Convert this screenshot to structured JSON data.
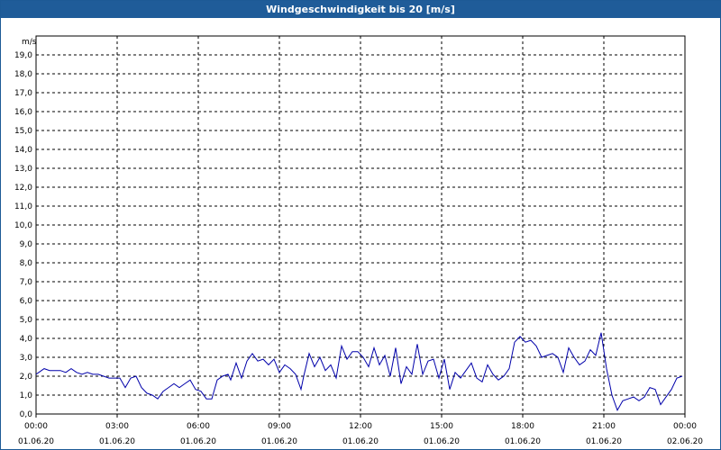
{
  "window": {
    "title": "Windgeschwindigkeit bis 20 [m/s]"
  },
  "colors": {
    "titlebar": "#1f5c99",
    "series": "#0000aa",
    "grid": "#000000"
  },
  "chart_data": {
    "type": "line",
    "title": "Windgeschwindigkeit bis 20 [m/s]",
    "ylabel": "m/s",
    "xlabel": "",
    "ylim": [
      0,
      20
    ],
    "xlim": [
      0,
      24
    ],
    "grid": true,
    "y_ticks": [
      "0,0",
      "1,0",
      "2,0",
      "3,0",
      "4,0",
      "5,0",
      "6,0",
      "7,0",
      "8,0",
      "9,0",
      "10,0",
      "11,0",
      "12,0",
      "13,0",
      "14,0",
      "15,0",
      "16,0",
      "17,0",
      "18,0",
      "19,0"
    ],
    "x_ticks": [
      {
        "time": "00:00",
        "date": "01.06.20",
        "hour": 0
      },
      {
        "time": "03:00",
        "date": "01.06.20",
        "hour": 3
      },
      {
        "time": "06:00",
        "date": "01.06.20",
        "hour": 6
      },
      {
        "time": "09:00",
        "date": "01.06.20",
        "hour": 9
      },
      {
        "time": "12:00",
        "date": "01.06.20",
        "hour": 12
      },
      {
        "time": "15:00",
        "date": "01.06.20",
        "hour": 15
      },
      {
        "time": "18:00",
        "date": "01.06.20",
        "hour": 18
      },
      {
        "time": "21:00",
        "date": "01.06.20",
        "hour": 21
      },
      {
        "time": "00:00",
        "date": "02.06.20",
        "hour": 24
      }
    ],
    "series": [
      {
        "name": "",
        "x": [
          0,
          0.1,
          0.3,
          0.5,
          0.7,
          0.9,
          1.1,
          1.3,
          1.5,
          1.7,
          1.9,
          2.1,
          2.3,
          2.5,
          2.7,
          2.9,
          3.1,
          3.3,
          3.5,
          3.7,
          3.9,
          4.1,
          4.3,
          4.5,
          4.7,
          4.9,
          5.1,
          5.3,
          5.5,
          5.7,
          5.9,
          6.1,
          6.3,
          6.5,
          6.7,
          6.9,
          7.1,
          7.2,
          7.4,
          7.6,
          7.8,
          8.0,
          8.2,
          8.4,
          8.6,
          8.8,
          9.0,
          9.2,
          9.4,
          9.6,
          9.8,
          9.9,
          10.1,
          10.3,
          10.5,
          10.7,
          10.9,
          11.1,
          11.3,
          11.5,
          11.7,
          11.9,
          12.1,
          12.3,
          12.5,
          12.7,
          12.9,
          13.1,
          13.3,
          13.5,
          13.7,
          13.9,
          14.1,
          14.3,
          14.5,
          14.7,
          14.9,
          15.1,
          15.3,
          15.5,
          15.7,
          15.9,
          16.1,
          16.3,
          16.5,
          16.7,
          16.9,
          17.1,
          17.3,
          17.5,
          17.7,
          17.9,
          18.1,
          18.3,
          18.5,
          18.7,
          18.9,
          19.1,
          19.3,
          19.5,
          19.7,
          19.9,
          20.1,
          20.3,
          20.5,
          20.7,
          20.9,
          21.1,
          21.3,
          21.5,
          21.7,
          21.9,
          22.1,
          22.3,
          22.5,
          22.7,
          22.9,
          23.1,
          23.3,
          23.5,
          23.7,
          23.9
        ],
        "y": [
          2.1,
          2.2,
          2.4,
          2.3,
          2.3,
          2.3,
          2.2,
          2.4,
          2.2,
          2.1,
          2.2,
          2.1,
          2.1,
          2.0,
          1.9,
          1.9,
          1.9,
          1.4,
          1.9,
          2.0,
          1.4,
          1.1,
          1.0,
          0.8,
          1.2,
          1.4,
          1.6,
          1.4,
          1.6,
          1.8,
          1.3,
          1.2,
          0.8,
          0.8,
          1.8,
          2.0,
          2.1,
          1.8,
          2.7,
          1.9,
          2.8,
          3.2,
          2.8,
          2.9,
          2.6,
          2.9,
          2.2,
          2.6,
          2.4,
          2.1,
          1.3,
          2.0,
          3.2,
          2.5,
          3.0,
          2.3,
          2.6,
          1.9,
          3.6,
          2.9,
          3.3,
          3.3,
          3.0,
          2.5,
          3.5,
          2.6,
          3.1,
          2.0,
          3.5,
          1.6,
          2.5,
          2.1,
          3.7,
          2.1,
          2.8,
          2.9,
          1.9,
          2.9,
          1.3,
          2.2,
          1.9,
          2.3,
          2.7,
          1.9,
          1.7,
          2.6,
          2.1,
          1.8,
          2.0,
          2.4,
          3.8,
          4.1,
          3.8,
          3.9,
          3.6,
          3.0,
          3.1,
          3.2,
          3.0,
          2.2,
          3.5,
          3.0,
          2.6,
          2.8,
          3.4,
          3.1,
          4.3,
          2.4,
          1.0,
          0.2,
          0.7,
          0.8,
          0.9,
          0.7,
          0.9,
          1.4,
          1.3,
          0.5,
          0.9,
          1.3,
          1.9,
          2.0
        ]
      }
    ]
  }
}
